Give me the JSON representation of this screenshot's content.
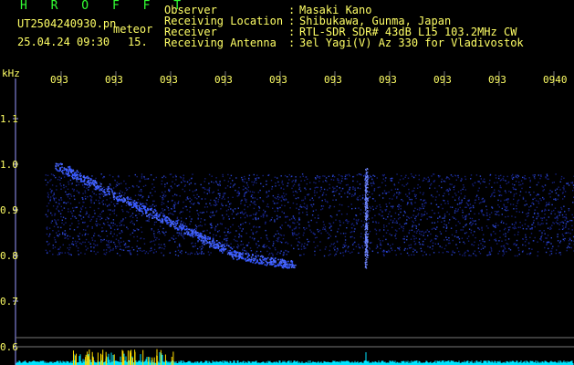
{
  "header": {
    "app_title": "H R O F F T",
    "filename": "UT2504240930.pn",
    "meteor_word": "meteor",
    "datetime": "25.04.24 09:30",
    "count": "15."
  },
  "info": [
    {
      "label": "Observer",
      "value": "Masaki Kano"
    },
    {
      "label": "Receiving Location",
      "value": "Shibukawa, Gunma, Japan"
    },
    {
      "label": "Receiver",
      "value": "RTL-SDR SDR# 43dB L15 103.2MHz CW"
    },
    {
      "label": "Receiving Antenna",
      "value": "3el Yagi(V) Az 330 for Vladivostok"
    }
  ],
  "chart_data": {
    "type": "heatmap",
    "ylabel": "kHz",
    "y_ticks": [
      "1.1",
      "1.0",
      "0.9",
      "0.8",
      "0.7",
      "0.6"
    ],
    "x_ticks": [
      "093",
      "093",
      "093",
      "093",
      "093",
      "093",
      "093",
      "093",
      "093",
      "0940"
    ],
    "ylim": [
      0.6,
      1.1
    ],
    "noise_band_khz": [
      0.8,
      0.98
    ],
    "meteor_trail": [
      {
        "x_frac": 0.07,
        "khz": 1.0
      },
      {
        "x_frac": 0.18,
        "khz": 0.93
      },
      {
        "x_frac": 0.3,
        "khz": 0.86
      },
      {
        "x_frac": 0.4,
        "khz": 0.8
      },
      {
        "x_frac": 0.5,
        "khz": 0.78
      }
    ],
    "colors": {
      "signal": "#3355ff",
      "trace": "#00e5ff",
      "text": "#ffff66"
    }
  }
}
